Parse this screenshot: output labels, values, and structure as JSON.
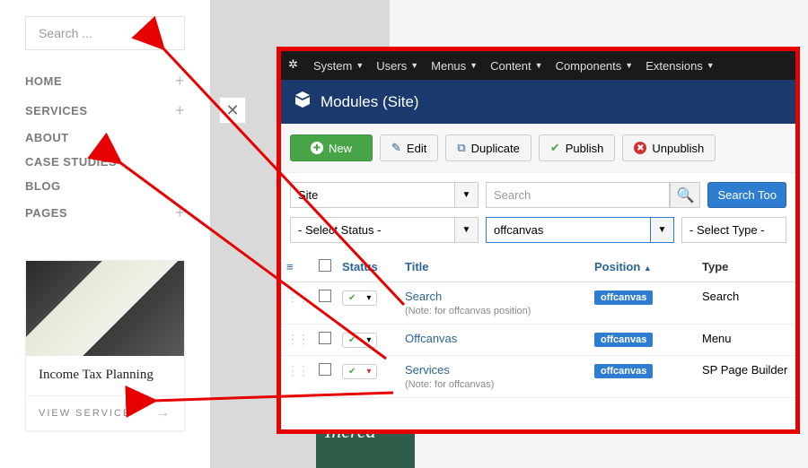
{
  "sidebar": {
    "search_placeholder": "Search ...",
    "items": [
      {
        "label": "HOME",
        "plus": true
      },
      {
        "label": "SERVICES",
        "plus": true
      },
      {
        "label": "ABOUT",
        "plus": false
      },
      {
        "label": "CASE STUDIES",
        "plus": false
      },
      {
        "label": "BLOG",
        "plus": false
      },
      {
        "label": "PAGES",
        "plus": true
      }
    ]
  },
  "card": {
    "title": "Income Tax Planning",
    "cta": "VIEW SERVICE"
  },
  "greenblock": "Increa",
  "admin": {
    "topmenu": [
      "System",
      "Users",
      "Menus",
      "Content",
      "Components",
      "Extensions"
    ],
    "header": "Modules (Site)",
    "toolbar": {
      "new": "New",
      "edit": "Edit",
      "duplicate": "Duplicate",
      "publish": "Publish",
      "unpublish": "Unpublish"
    },
    "filters": {
      "scope": "Site",
      "search_placeholder": "Search",
      "search_tools": "Search Too",
      "status": "- Select Status -",
      "position": "offcanvas",
      "type": "- Select Type -"
    },
    "columns": {
      "status": "Status",
      "title": "Title",
      "position": "Position",
      "type": "Type"
    },
    "sort_indicator": "▲",
    "rows": [
      {
        "title": "Search",
        "note": "(Note: for offcanvas position)",
        "position": "offcanvas",
        "type": "Search"
      },
      {
        "title": "Offcanvas",
        "note": "",
        "position": "offcanvas",
        "type": "Menu"
      },
      {
        "title": "Services",
        "note": "(Note: for offcanvas)",
        "position": "offcanvas",
        "type": "SP Page Builder"
      }
    ]
  }
}
